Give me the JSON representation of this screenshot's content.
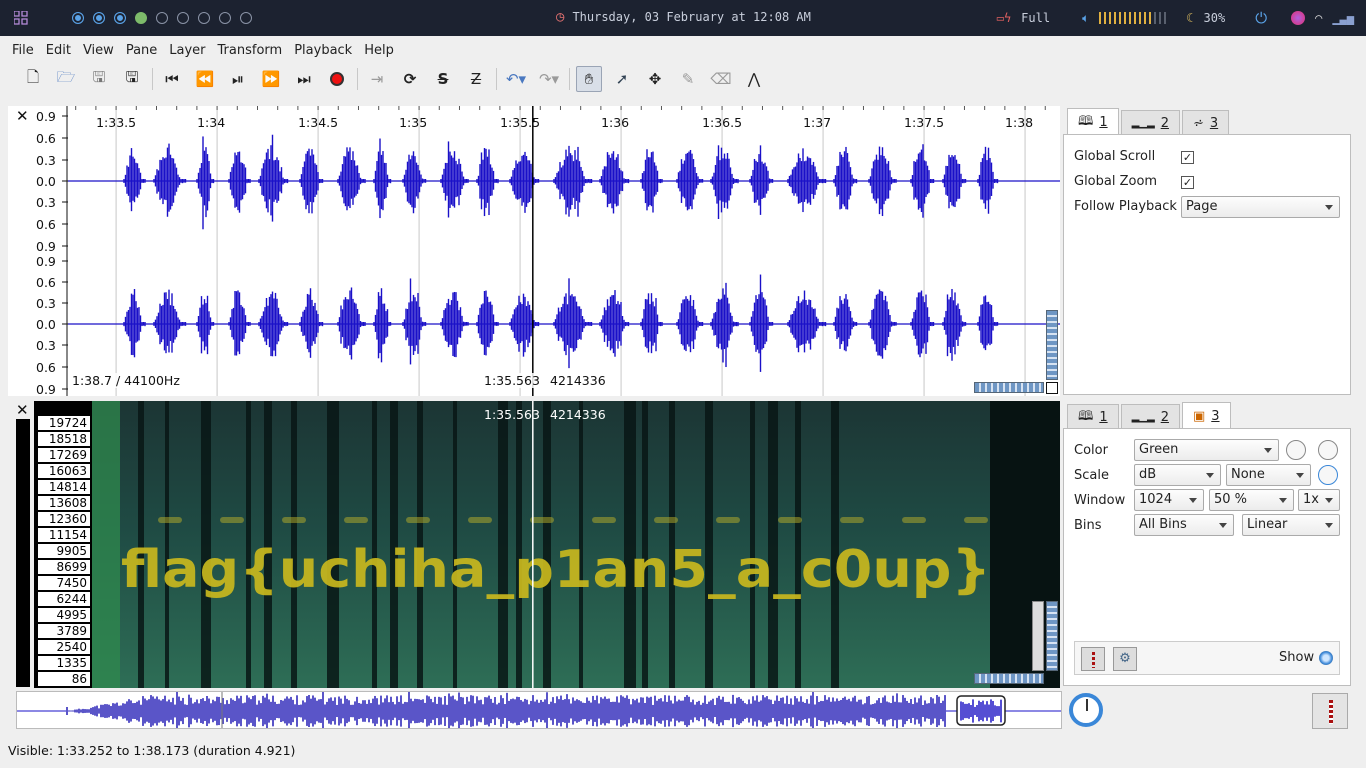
{
  "system_bar": {
    "datetime": "Thursday, 03 February at 12:08 AM",
    "battery": "Full",
    "brightness": "30%",
    "workspaces": [
      "active",
      "active",
      "active",
      "green",
      "empty",
      "empty",
      "empty",
      "empty",
      "empty"
    ],
    "volume_level": 0.78
  },
  "menu": [
    "File",
    "Edit",
    "View",
    "Pane",
    "Layer",
    "Transform",
    "Playback",
    "Help"
  ],
  "toolbar": {
    "icons": [
      "new-file-icon",
      "open-folder-icon",
      "save-icon",
      "save-as-icon",
      "skip-start-icon",
      "rewind-icon",
      "play-pause-icon",
      "fast-forward-icon",
      "skip-end-icon",
      "record-icon",
      "play-selection-icon",
      "loop-icon",
      "constrain-icon",
      "normalize-icon",
      "undo-icon",
      "redo-icon",
      "navigate-hand-icon",
      "select-arrow-icon",
      "move-icon",
      "draw-icon",
      "erase-icon",
      "measure-icon"
    ],
    "active": "navigate-hand-icon"
  },
  "waveform": {
    "time_ticks": [
      "1:33.5",
      "1:34",
      "1:34.5",
      "1:35",
      "1:35.5",
      "1:36",
      "1:36.5",
      "1:37",
      "1:37.5",
      "1:38"
    ],
    "tick_seconds": [
      93.5,
      94,
      94.5,
      95,
      95.5,
      96,
      96.5,
      97,
      97.5,
      98
    ],
    "amp_labels_top": [
      "0.9",
      "0.6",
      "0.3",
      "0.0",
      "0.3",
      "0.6",
      "0.9"
    ],
    "amp_labels_bottom": [
      "0.9",
      "0.6",
      "0.3",
      "0.0",
      "0.3",
      "0.6",
      "0.9"
    ],
    "info_left": "1:38.7 / 44100Hz",
    "cursor_time": "1:35.563",
    "cursor_frame": "4214336",
    "cursor_seconds": 95.563
  },
  "spectrogram": {
    "freq_labels": [
      "19724",
      "18518",
      "17269",
      "16063",
      "14814",
      "13608",
      "12360",
      "11154",
      "9905",
      "8699",
      "7450",
      "6244",
      "4995",
      "3789",
      "2540",
      "1335",
      "86"
    ],
    "cursor_time": "1:35.563",
    "cursor_frame": "4214336",
    "hidden_text": "flag{uchiha_p1an5_a_c0up}"
  },
  "panel_top": {
    "tabs": [
      "1",
      "2",
      "3"
    ],
    "selected": "1",
    "global_scroll_label": "Global Scroll",
    "global_scroll": true,
    "global_zoom_label": "Global Zoom",
    "global_zoom": true,
    "follow_label": "Follow Playback",
    "follow_value": "Page"
  },
  "panel_bottom": {
    "tabs": [
      "1",
      "2",
      "3"
    ],
    "selected": "3",
    "color_label": "Color",
    "color_value": "Green",
    "scale_label": "Scale",
    "scale_value": "dB",
    "scale_value2": "None",
    "window_label": "Window",
    "window_size": "1024",
    "window_overlap": "50 %",
    "window_zoom": "1x",
    "bins_label": "Bins",
    "bins_value": "All Bins",
    "bins_scale": "Linear",
    "show_label": "Show"
  },
  "status": "Visible: 1:33.252 to 1:38.173 (duration 4.921)",
  "colors": {
    "waveform": "#1a10c8",
    "spectrogram_text": "#c9b81e",
    "spectrogram_bg": "#0d2e2f",
    "sysbar_bg": "#1c2230"
  }
}
